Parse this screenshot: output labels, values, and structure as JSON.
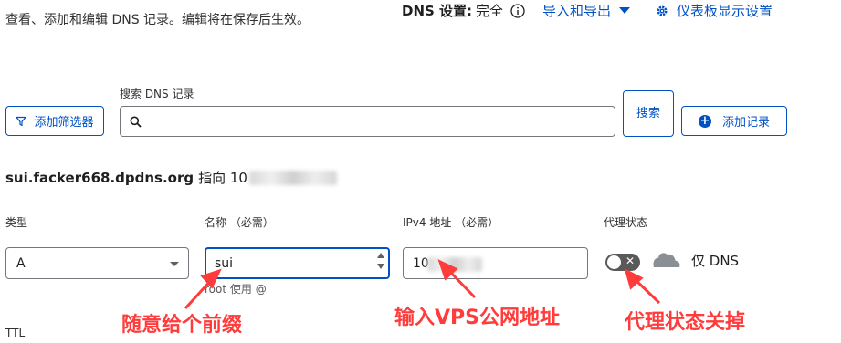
{
  "header": {
    "description": "查看、添加和编辑 DNS 记录。编辑将在保存后生效。",
    "dns_settings_label": "DNS 设置:",
    "dns_settings_value": "完全",
    "import_export": "导入和导出",
    "dashboard_settings": "仪表板显示设置"
  },
  "toolbar": {
    "add_filter": "添加筛选器",
    "search_label": "搜索 DNS 记录",
    "search_placeholder": "",
    "search_button": "搜索",
    "add_record": "添加记录"
  },
  "record": {
    "host": "sui.facker668.dpdns.org",
    "points_to": "指向 10"
  },
  "form": {
    "type_label": "类型",
    "type_value": "A",
    "name_label": "名称 （必需）",
    "name_value": "sui",
    "name_hint": "root 使用 @",
    "ipv4_label": "IPv4 地址 （必需）",
    "ipv4_value": "10",
    "proxy_label": "代理状态",
    "proxy_status": "仅 DNS",
    "ttl_label": "TTL"
  },
  "annotations": {
    "name_note": "随意给个前缀",
    "ip_note": "输入VPS公网地址",
    "proxy_note": "代理状态关掉"
  },
  "colors": {
    "accent": "#0051c3",
    "annotation": "#ff3b3b"
  }
}
